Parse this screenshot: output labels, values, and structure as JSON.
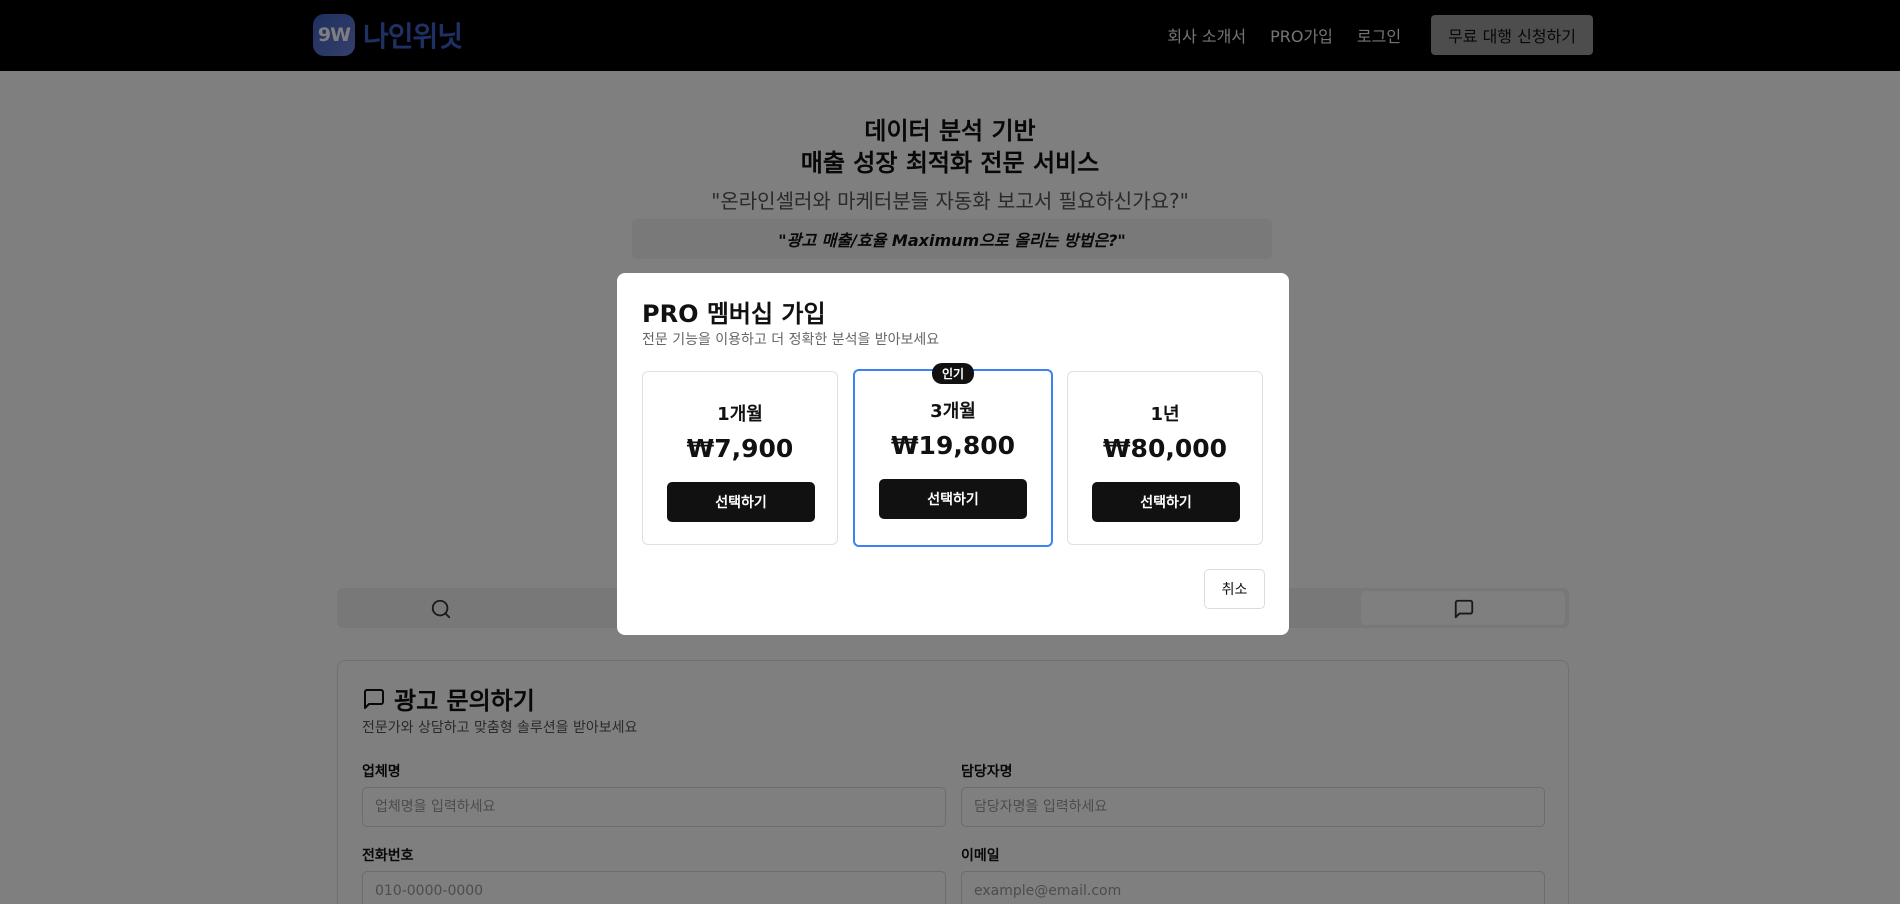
{
  "header": {
    "logo_mark": "9W",
    "logo_text": "나인위닛",
    "nav": [
      "회사 소개서",
      "PRO가입",
      "로그인"
    ],
    "cta": "무료 대행 신청하기"
  },
  "hero": {
    "line1": "데이터 분석 기반",
    "line2": "매출 성장 최적화 전문 서비스",
    "quote": "\"온라인셀러와 마케터분들 자동화 보고서 필요하신가요?\"",
    "highlight": "\"광고 매출/효율 Maximum으로 올리는 방법은?\""
  },
  "tabs": {
    "left_icon": "search-icon",
    "right_icon": "message-icon"
  },
  "form": {
    "title": "광고 문의하기",
    "title_icon": "message-icon",
    "subtitle": "전문가와 상담하고 맞춤형 솔루션을 받아보세요",
    "company_label": "업체명",
    "company_placeholder": "업체명을 입력하세요",
    "manager_label": "담당자명",
    "manager_placeholder": "담당자명을 입력하세요",
    "phone_label": "전화번호",
    "phone_placeholder": "010-0000-0000",
    "email_label": "이메일",
    "email_placeholder": "example@email.com"
  },
  "modal": {
    "title": "PRO 멤버십 가입",
    "subtitle": "전문 기능을 이용하고 더 정확한 분석을 받아보세요",
    "plans": [
      {
        "name": "1개월",
        "price": "₩7,900",
        "button": "선택하기"
      },
      {
        "name": "3개월",
        "price": "₩19,800",
        "button": "선택하기",
        "badge": "인기"
      },
      {
        "name": "1년",
        "price": "₩80,000",
        "button": "선택하기"
      }
    ],
    "cancel": "취소"
  },
  "colors": {
    "accent_border": "#3b82f6",
    "header_bg": "#000000",
    "button_dark": "#111111",
    "logo_blue": "#3f63c9"
  }
}
